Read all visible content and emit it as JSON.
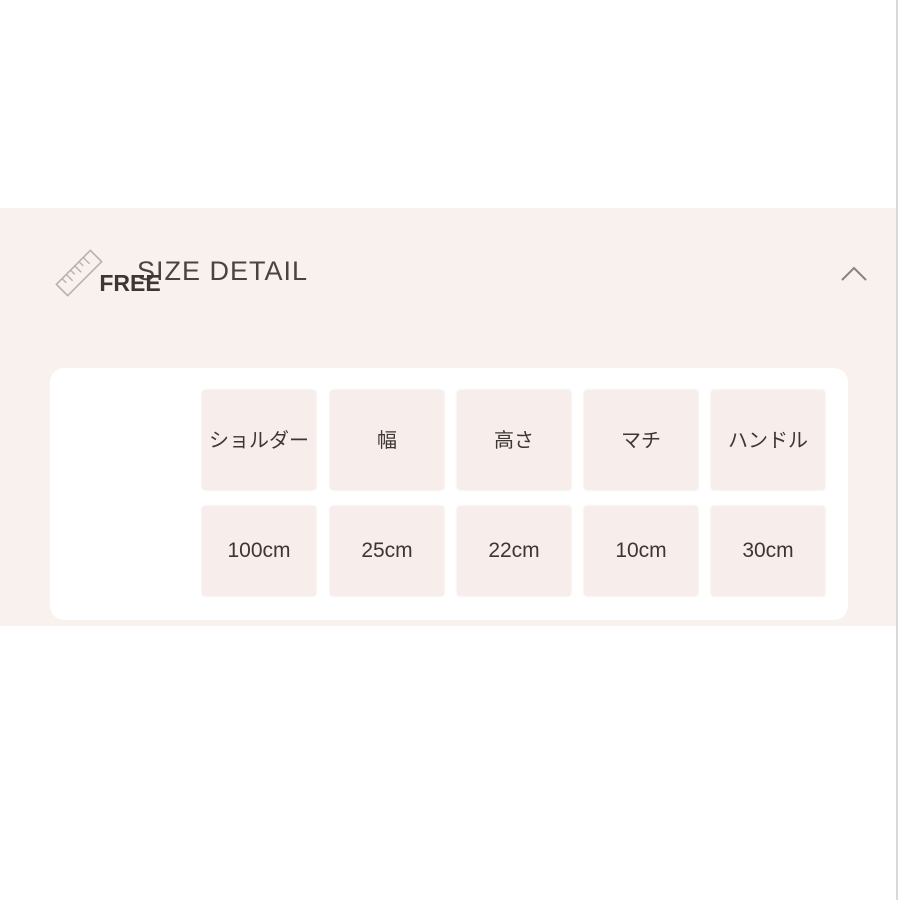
{
  "section": {
    "title": "SIZE DETAIL",
    "icon": "ruler-icon",
    "toggle_icon": "chevron-up-icon"
  },
  "table": {
    "size_label": "FREE",
    "headers": [
      "ショルダー",
      "幅",
      "高さ",
      "マチ",
      "ハンドル"
    ],
    "values": [
      "100cm",
      "25cm",
      "22cm",
      "10cm",
      "30cm"
    ]
  },
  "colors": {
    "panel_bg": "#f8f1ee",
    "card_bg": "#ffffff",
    "cell_bg": "#f7eeeb",
    "text": "#3d3633"
  }
}
